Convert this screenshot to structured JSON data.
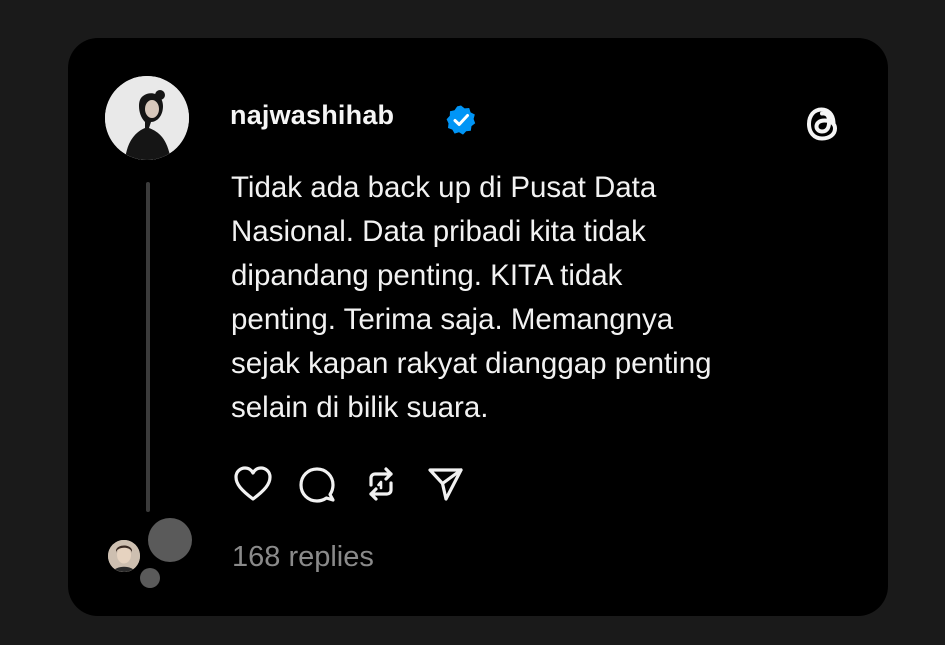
{
  "post": {
    "username": "najwashihab",
    "text": "Tidak ada back up di Pusat Data\nNasional. Data pribadi kita tidak\ndipandang penting. KITA tidak\npenting. Terima saja. Memangnya\nsejak kapan rakyat dianggap penting\nselain di bilik suara.",
    "replies_label": "168 replies",
    "verified": true
  },
  "icons": {
    "verified": "verified-badge-icon",
    "app_logo": "threads-logo-icon",
    "like": "heart-icon",
    "comment": "comment-bubble-icon",
    "repost": "repost-icon",
    "share": "send-icon"
  },
  "colors": {
    "background": "#1a1a1a",
    "card": "#000000",
    "text": "#f2f2f2",
    "muted": "#8a8a8a",
    "verified": "#0095f6"
  }
}
